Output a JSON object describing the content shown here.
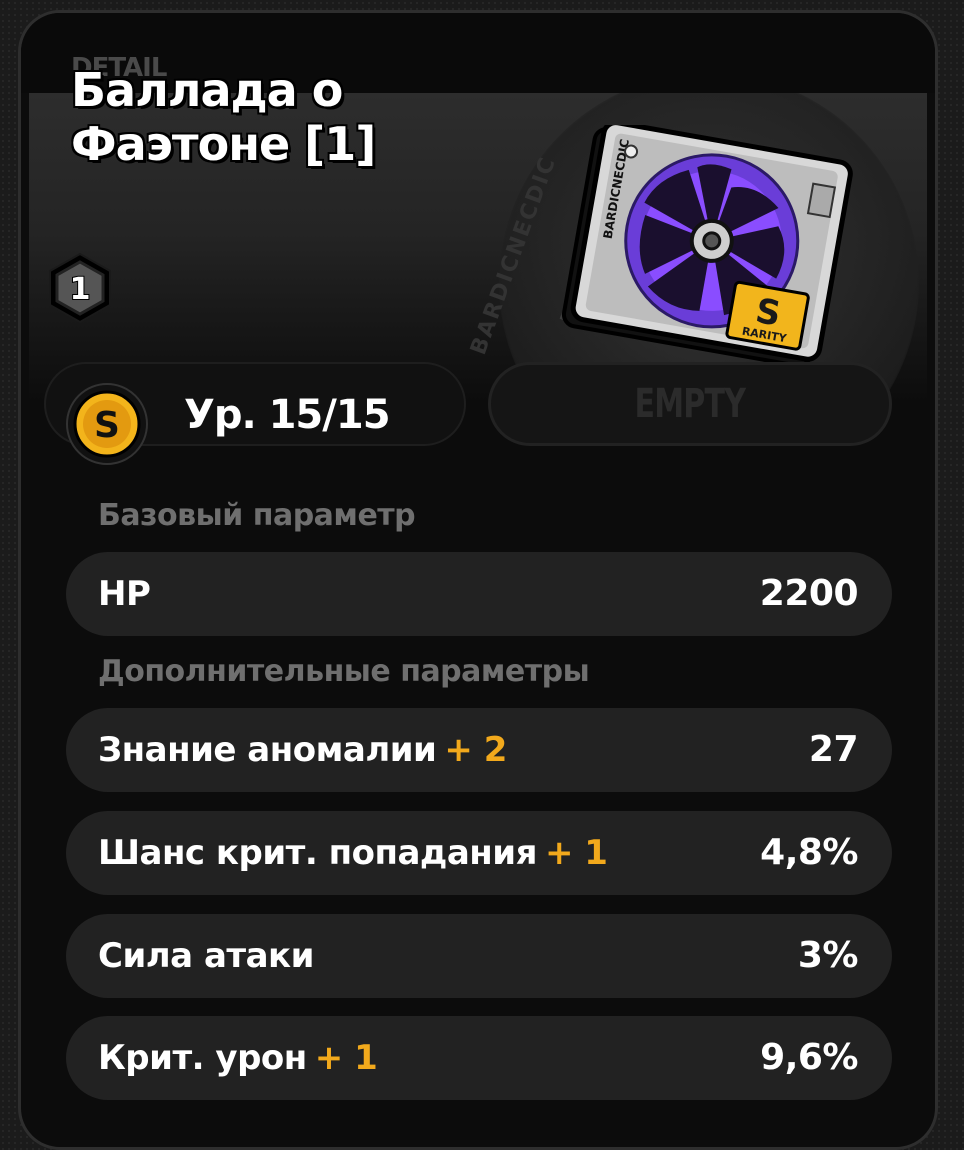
{
  "header": {
    "label": "DETAIL"
  },
  "disc": {
    "name": "Баллада о Фаэтоне [1]",
    "slot": "1",
    "rarity_letter": "S",
    "rarity_label": "RARITY",
    "brand_text": "BARDICNECDIC",
    "level_text": "Ур. 15/15",
    "empty_slot_label": "EMPTY"
  },
  "base": {
    "section_title": "Базовый параметр",
    "stats": [
      {
        "name": "HP",
        "bonus": "",
        "value": "2200"
      }
    ]
  },
  "additional": {
    "section_title": "Дополнительные параметры",
    "stats": [
      {
        "name": "Знание аномалии",
        "bonus": "+ 2",
        "value": "27"
      },
      {
        "name": "Шанс крит. попадания",
        "bonus": "+ 1",
        "value": "4,8%"
      },
      {
        "name": "Сила атаки",
        "bonus": "",
        "value": "3%"
      },
      {
        "name": "Крит. урон",
        "bonus": "+ 1",
        "value": "9,6%"
      }
    ]
  },
  "colors": {
    "accent": "#f2a91c",
    "row_bg": "#222222",
    "label_gray": "#6f6f6f",
    "disc_purple": "#8a4dff"
  }
}
